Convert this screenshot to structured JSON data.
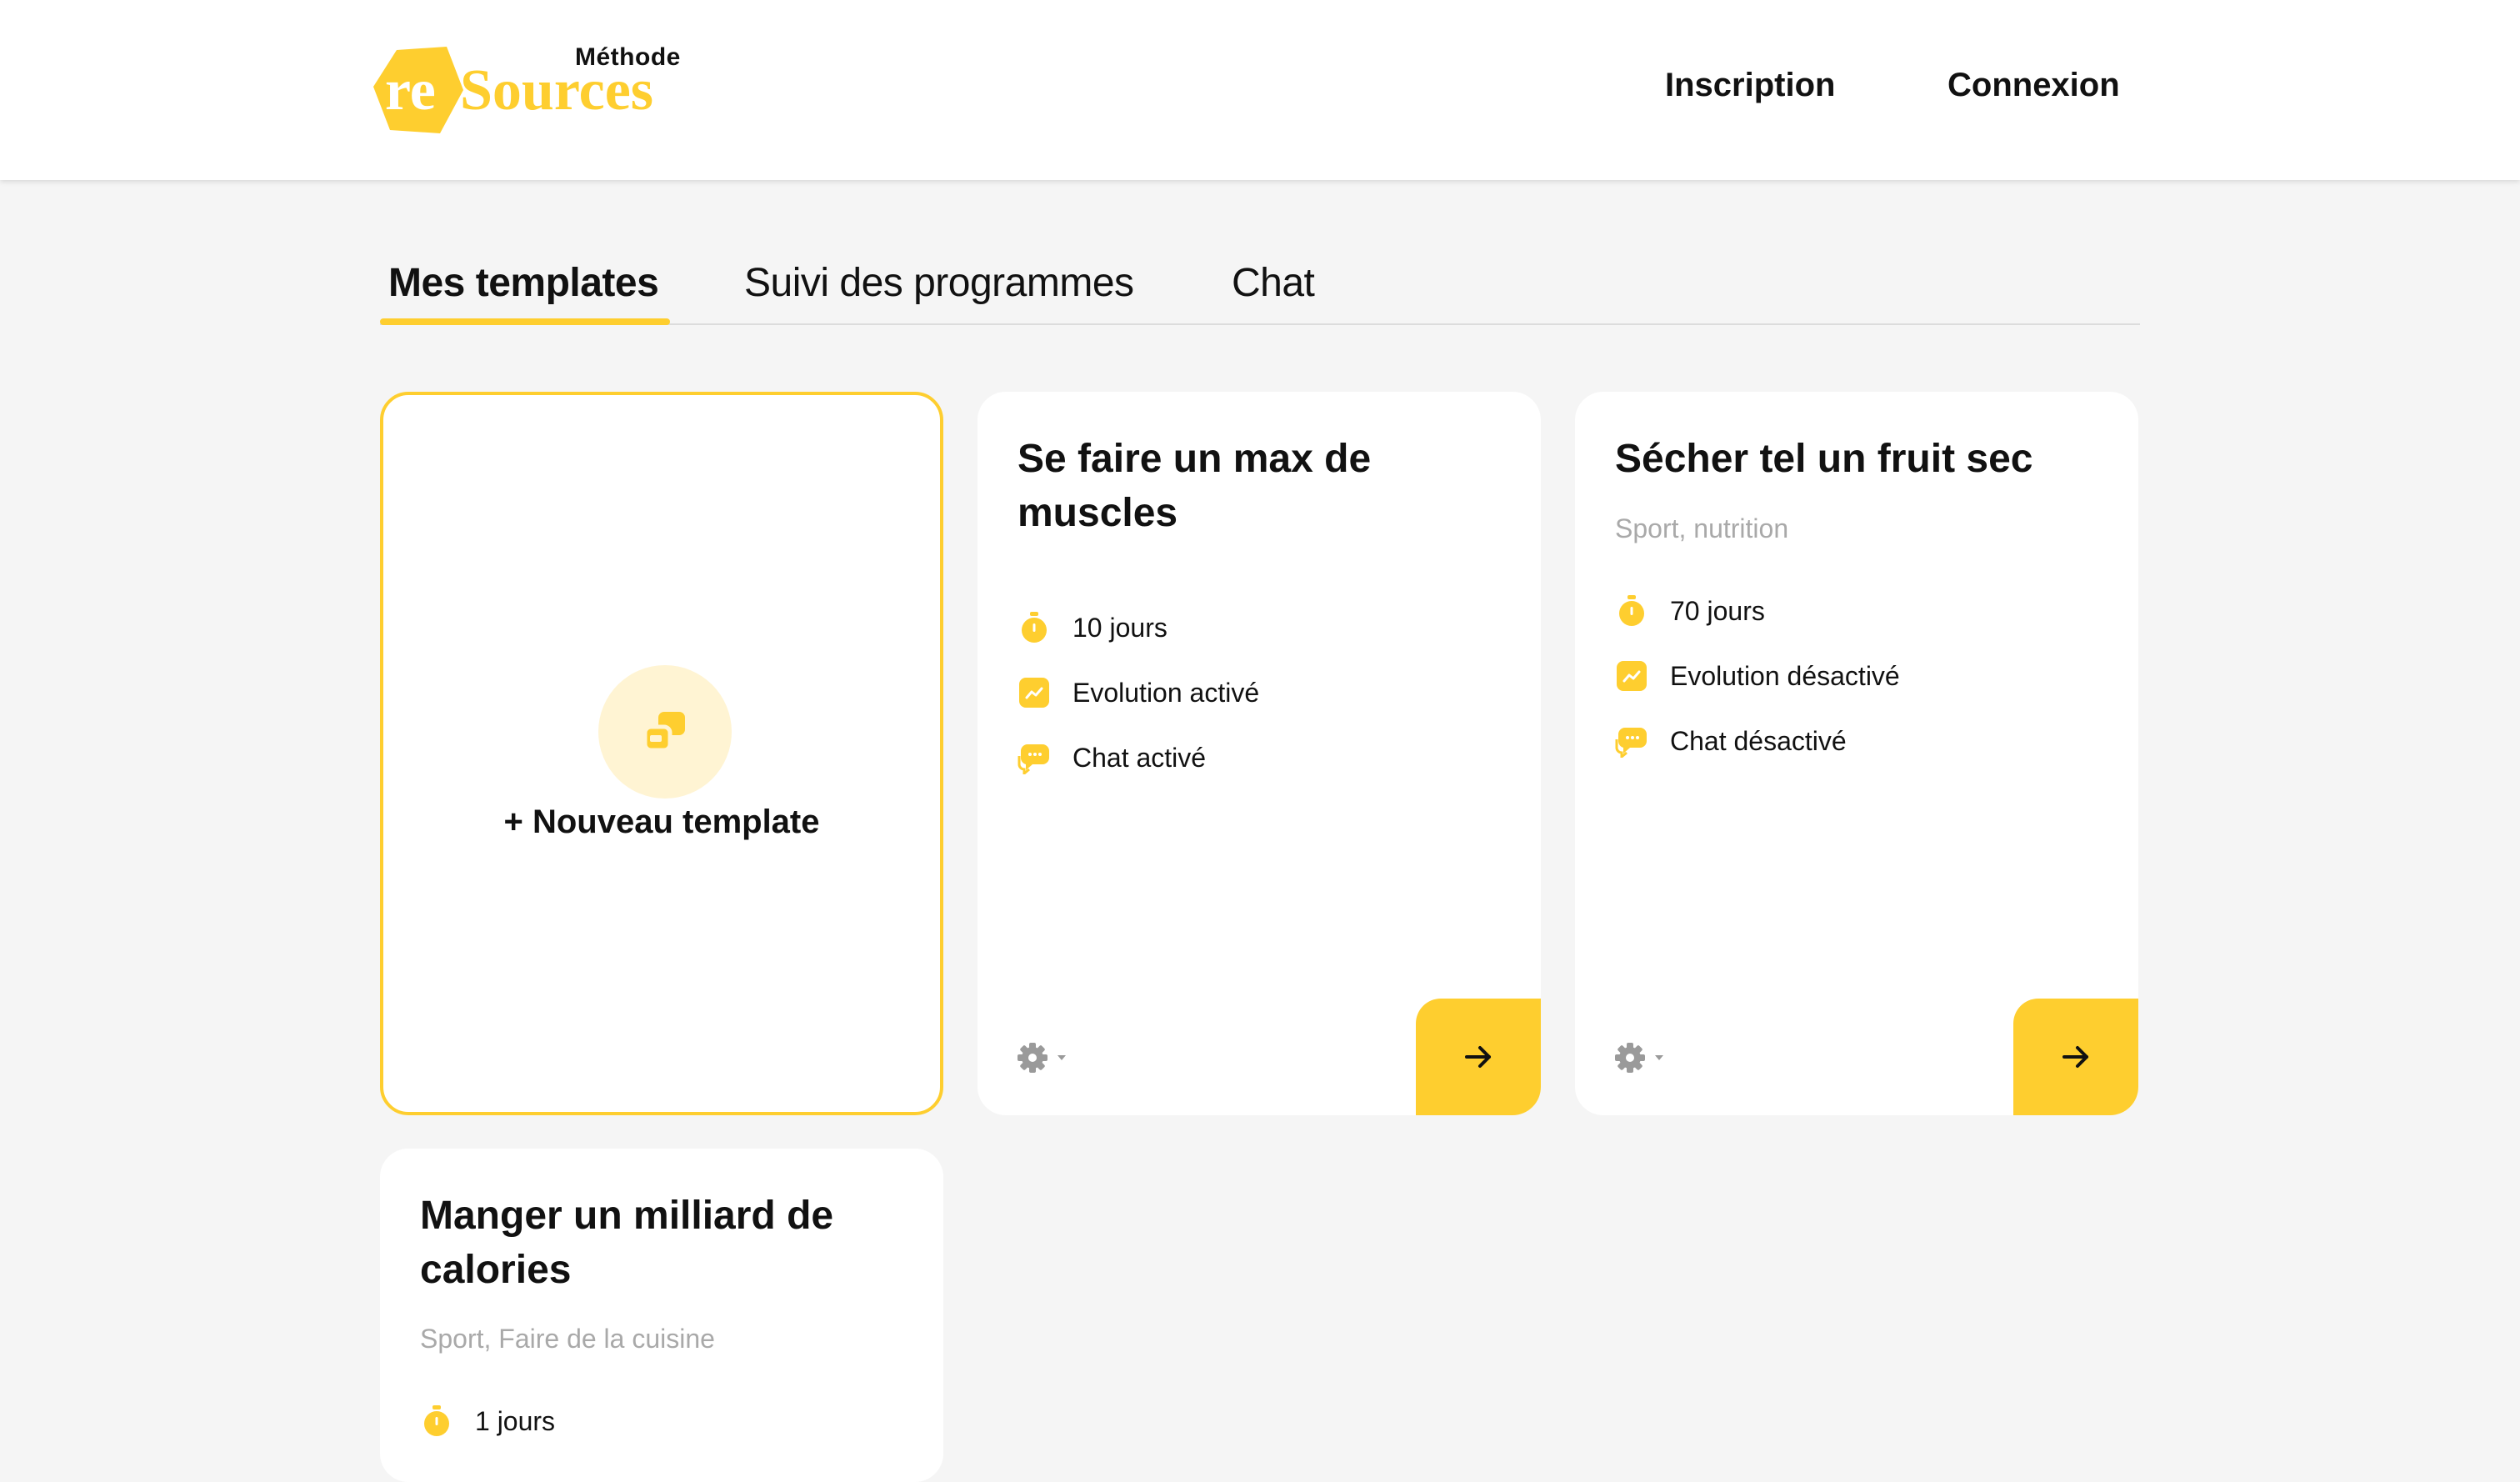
{
  "header": {
    "logo": {
      "small_text": "Méthode",
      "prefix": "re",
      "suffix": "Sources"
    },
    "nav": {
      "inscription": "Inscription",
      "connexion": "Connexion"
    }
  },
  "tabs": [
    {
      "label": "Mes templates",
      "active": true
    },
    {
      "label": "Suivi des programmes",
      "active": false
    },
    {
      "label": "Chat",
      "active": false
    }
  ],
  "new_template": {
    "label": "+ Nouveau template",
    "icon": "copy-icon"
  },
  "templates": [
    {
      "title": "Se faire un max de muscles",
      "tags": "",
      "duration": "10 jours",
      "evolution": "Evolution activé",
      "chat": "Chat activé"
    },
    {
      "title": "Sécher tel un fruit sec",
      "tags": "Sport, nutrition",
      "duration": "70 jours",
      "evolution": "Evolution désactivé",
      "chat": "Chat désactivé"
    },
    {
      "title": "Manger un milliard de calories",
      "tags": "Sport, Faire de la cuisine",
      "duration": "1 jours"
    }
  ],
  "icons": {
    "duration": "stopwatch-icon",
    "evolution": "trend-chart-icon",
    "chat": "chat-bubbles-icon",
    "settings": "gear-icon",
    "open": "arrow-right-icon"
  },
  "colors": {
    "accent": "#fece2f",
    "accent_light": "#fff4d3",
    "background": "#f5f5f5",
    "muted_text": "#a9a9a9"
  }
}
